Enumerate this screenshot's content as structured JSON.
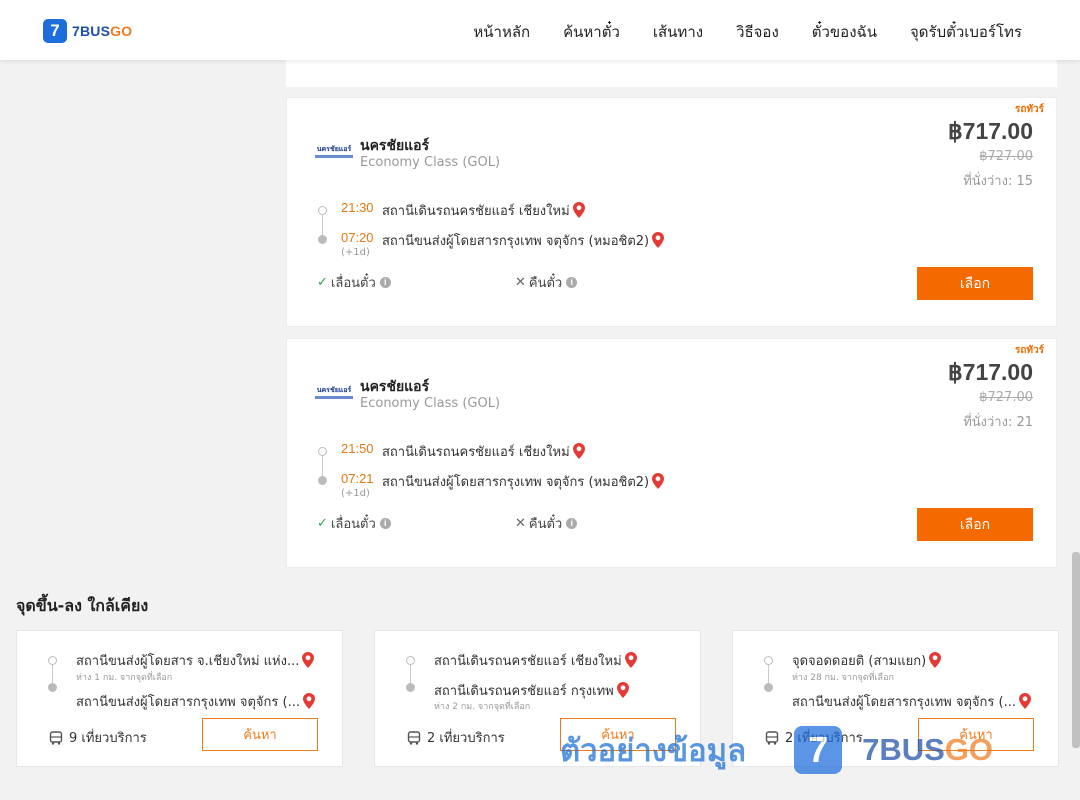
{
  "header": {
    "logo_number": "7",
    "logo_text_a": "7BUS",
    "logo_text_b": "GO",
    "nav": [
      "หน้าหลัก",
      "ค้นหาตั๋ว",
      "เส้นทาง",
      "วิธีจอง",
      "ตั๋วของฉัน",
      "จุดรับตั๋วเบอร์โทร"
    ]
  },
  "trips": [
    {
      "tag": "รถทัวร์",
      "operator_logo_text": "นครชัยแอร์",
      "operator": "นครชัยแอร์",
      "class": "Economy Class (GOL)",
      "price": "฿717.00",
      "old_price": "฿727.00",
      "seats": "ที่นั่งว่าง: 15",
      "depart_time": "21:30",
      "depart_station": "สถานีเดินรถนครชัยแอร์ เชียงใหม่",
      "arrive_time": "07:20",
      "arrive_station": "สถานีขนส่งผู้โดยสารกรุงเทพ จตุจักร (หมอชิต2)",
      "plus_day": "(+1d)",
      "option_change": "เลื่อนตั๋ว",
      "option_refund": "คืนตั๋ว",
      "select_label": "เลือก"
    },
    {
      "tag": "รถทัวร์",
      "operator_logo_text": "นครชัยแอร์",
      "operator": "นครชัยแอร์",
      "class": "Economy Class (GOL)",
      "price": "฿717.00",
      "old_price": "฿727.00",
      "seats": "ที่นั่งว่าง: 21",
      "depart_time": "21:50",
      "depart_station": "สถานีเดินรถนครชัยแอร์ เชียงใหม่",
      "arrive_time": "07:21",
      "arrive_station": "สถานีขนส่งผู้โดยสารกรุงเทพ จตุจักร (หมอชิต2)",
      "plus_day": "(+1d)",
      "option_change": "เลื่อนตั๋ว",
      "option_refund": "คืนตั๋ว",
      "select_label": "เลือก"
    }
  ],
  "nearby": {
    "title": "จุดขึ้น-ลง ใกล้เคียง",
    "cards": [
      {
        "from": "สถานีขนส่งผู้โดยสาร จ.เชียงใหม่ แห่ง...",
        "from_dist": "ห่าง 1 กม. จากจุดที่เลือก",
        "to": "สถานีขนส่งผู้โดยสารกรุงเทพ จตุจักร (...",
        "to_dist": "",
        "trips": "9 เที่ยวบริการ",
        "search_label": "ค้นหา"
      },
      {
        "from": "สถานีเดินรถนครชัยแอร์ เชียงใหม่",
        "from_dist": "",
        "to": "สถานีเดินรถนครชัยแอร์ กรุงเทพ",
        "to_dist": "ห่าง 2 กม. จากจุดที่เลือก",
        "trips": "2 เที่ยวบริการ",
        "search_label": "ค้นหา"
      },
      {
        "from": "จุดจอดดอยติ (สามแยก)",
        "from_dist": "ห่าง 28 กม. จากจุดที่เลือก",
        "to": "สถานีขนส่งผู้โดยสารกรุงเทพ จตุจักร (...",
        "to_dist": "",
        "trips": "2 เที่ยวบริการ",
        "search_label": "ค้นหา"
      }
    ]
  },
  "watermark": {
    "text": "ตัวอย่างข้อมูล",
    "badge": "7",
    "brand_a": "7BUS",
    "brand_b": "GO"
  },
  "colors": {
    "accent": "#f56a00",
    "time": "#e7780f",
    "brand_blue": "#1e6ddc",
    "pin_red": "#e53935",
    "check_green": "#2da44e"
  }
}
